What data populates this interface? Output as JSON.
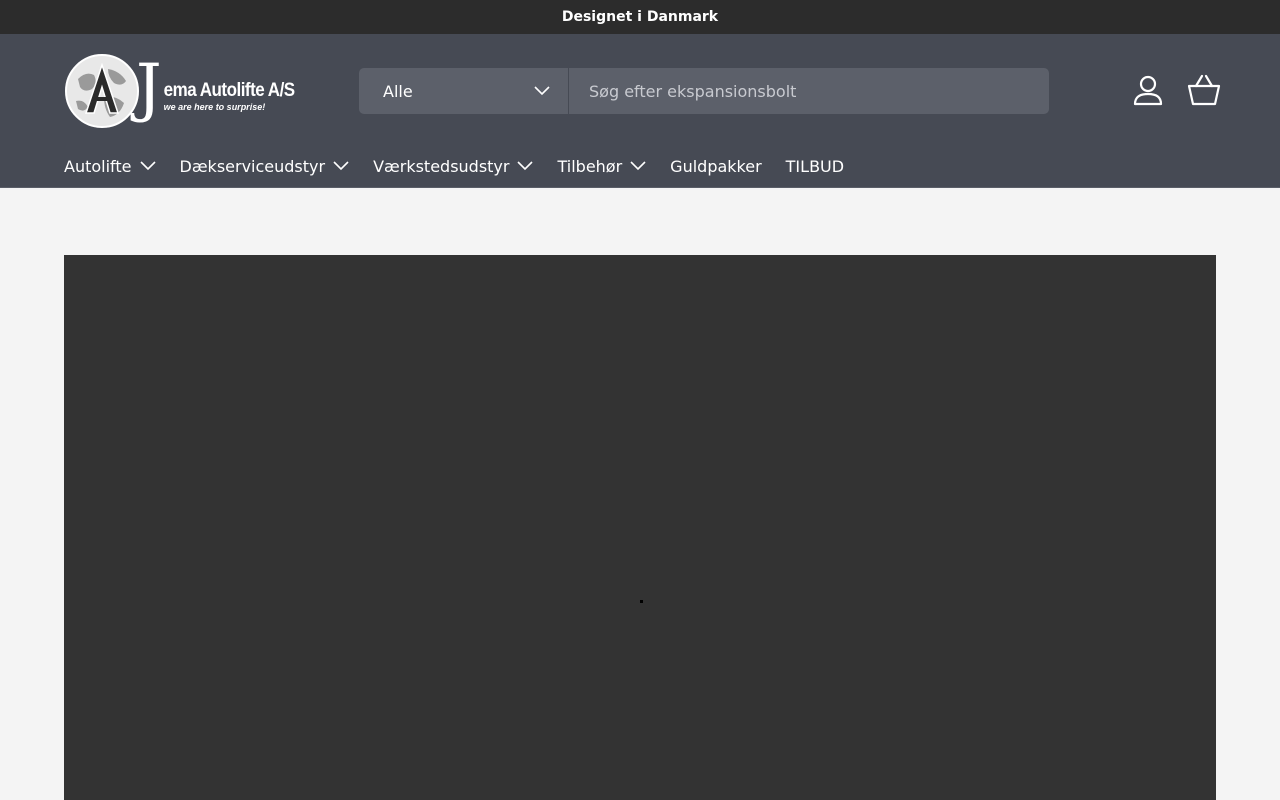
{
  "announcement": {
    "text": "Designet i Danmark"
  },
  "logo": {
    "letter": "J",
    "name": "ema Autolifte A/S",
    "tagline": "we are here to surprise!",
    "icon": "globe-logo-icon"
  },
  "search": {
    "category_label": "Alle",
    "placeholder": "Søg efter ekspansionsbolt",
    "value": ""
  },
  "header_icons": {
    "account": "user-icon",
    "cart": "basket-icon"
  },
  "nav": {
    "items": [
      {
        "label": "Autolifte",
        "has_dropdown": true
      },
      {
        "label": "Dækserviceudstyr",
        "has_dropdown": true
      },
      {
        "label": "Værkstedsudstyr",
        "has_dropdown": true
      },
      {
        "label": "Tilbehør",
        "has_dropdown": true
      },
      {
        "label": "Guldpakker",
        "has_dropdown": false
      },
      {
        "label": "TILBUD",
        "has_dropdown": false
      }
    ]
  },
  "colors": {
    "announcement_bg": "#2c2c2c",
    "header_bg": "#464a54",
    "search_bg": "#5c606a",
    "page_bg": "#f4f4f4",
    "hero_bg": "#333333"
  }
}
